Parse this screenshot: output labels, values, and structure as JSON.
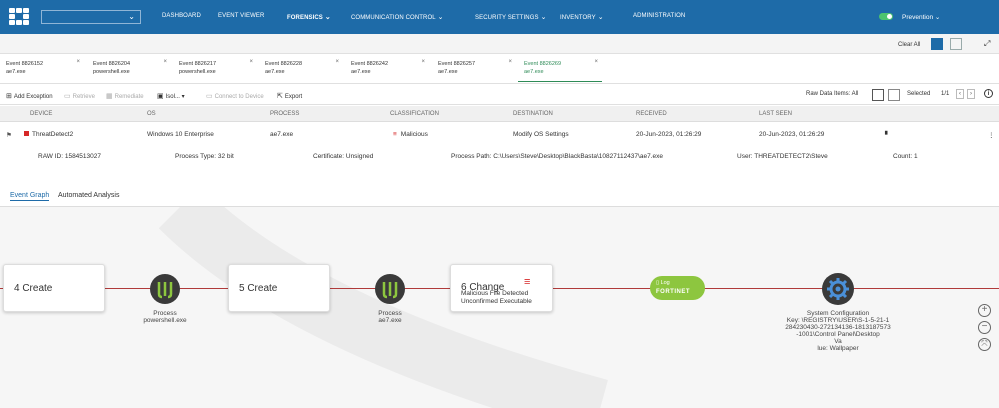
{
  "nav": {
    "items": [
      {
        "label": "DASHBOARD"
      },
      {
        "label": "EVENT VIEWER"
      },
      {
        "label": "FORENSICS"
      },
      {
        "label": "COMMUNICATION CONTROL"
      },
      {
        "label": "SECURITY SETTINGS"
      },
      {
        "label": "INVENTORY"
      },
      {
        "label": "ADMINISTRATION"
      }
    ],
    "prevention_label": "Prevention"
  },
  "subbar": {
    "clear_all": "Clear All"
  },
  "event_tabs": [
    {
      "id": "Event 8826152",
      "proc": "ae7.exe"
    },
    {
      "id": "Event 8826204",
      "proc": "powershell.exe"
    },
    {
      "id": "Event 8826217",
      "proc": "powershell.exe"
    },
    {
      "id": "Event 8826228",
      "proc": "ae7.exe"
    },
    {
      "id": "Event 8826242",
      "proc": "ae7.exe"
    },
    {
      "id": "Event 8826257",
      "proc": "ae7.exe"
    },
    {
      "id": "Event 8826269",
      "proc": "ae7.exe"
    }
  ],
  "toolbar": {
    "add_exception": "Add Exception",
    "retrieve": "Retrieve",
    "remediate": "Remediate",
    "isolate": "Isol...",
    "connect": "Connect to Device",
    "export": "Export",
    "raw_items": "Raw Data Items: All",
    "selected": "Selected",
    "page": "1/1"
  },
  "table": {
    "headers": {
      "device": "DEVICE",
      "os": "OS",
      "process": "PROCESS",
      "classification": "CLASSIFICATION",
      "destination": "DESTINATION",
      "received": "RECEIVED",
      "last_seen": "LAST SEEN"
    },
    "row": {
      "device": "ThreatDetect2",
      "os": "Windows 10 Enterprise",
      "process": "ae7.exe",
      "classification": "Malicious",
      "destination": "Modify OS Settings",
      "received": "20-Jun-2023, 01:26:29",
      "last_seen": "20-Jun-2023, 01:26:29"
    },
    "details": {
      "raw_id": "RAW ID: 1584513027",
      "process_type": "Process Type: 32 bit",
      "certificate": "Certificate: Unsigned",
      "process_path": "Process Path: C:\\Users\\Steve\\Desktop\\BlackBasta\\10827112437\\ae7.exe",
      "user": "User: THREATDETECT2\\Steve",
      "count": "Count: 1"
    }
  },
  "graph_tabs": {
    "event_graph": "Event Graph",
    "automated": "Automated Analysis"
  },
  "graph": {
    "box1": "4 Create",
    "proc1": [
      "Process",
      "powershell.exe"
    ],
    "box2": "5 Create",
    "proc2": [
      "Process",
      "ae7.exe"
    ],
    "box3_title": "6 Change",
    "box3_sub1": "Malicious File Detected",
    "box3_sub2": "Unconfirmed Executable",
    "log_label": "Log",
    "log_brand": "FORTINET",
    "cfg_lines": [
      "System Configuration",
      "Key: \\REGISTRY\\USER\\S-1-5-21-1",
      "284230430-272134136-1813187573",
      "-1001\\Control Panel\\Desktop",
      "Va",
      "lue: Wallpaper"
    ]
  },
  "colors": {
    "nav": "#1e6ba8",
    "malicious": "#d62828",
    "edge": "#b03a3a",
    "log": "#8dc63f"
  }
}
